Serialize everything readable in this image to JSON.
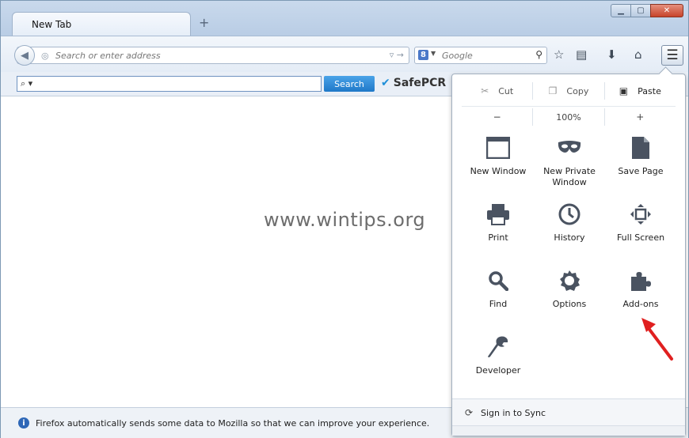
{
  "window": {
    "tab_title": "New Tab",
    "new_tab_symbol": "+",
    "controls": {
      "minimize": "▁",
      "maximize": "▢",
      "close": "✕"
    }
  },
  "navbar": {
    "url_placeholder": "Search or enter address",
    "search_engine": "Google",
    "search_placeholder": "Google"
  },
  "toolbar_addon": {
    "search_symbol": "⌕ ▾",
    "search_button": "Search",
    "brand": "SafePCR"
  },
  "content": {
    "watermark": "www.wintips.org"
  },
  "notification": {
    "text": "Firefox automatically sends some data to Mozilla so that we can improve your experience."
  },
  "menu_panel": {
    "edit": {
      "cut": "Cut",
      "copy": "Copy",
      "paste": "Paste"
    },
    "zoom": {
      "minus": "−",
      "level": "100%",
      "plus": "+"
    },
    "items": [
      {
        "label": "New Window",
        "icon": "window-icon"
      },
      {
        "label": "New Private Window",
        "icon": "mask-icon"
      },
      {
        "label": "Save Page",
        "icon": "page-icon"
      },
      {
        "label": "Print",
        "icon": "printer-icon"
      },
      {
        "label": "History",
        "icon": "clock-icon"
      },
      {
        "label": "Full Screen",
        "icon": "fullscreen-icon"
      },
      {
        "label": "Find",
        "icon": "magnifier-icon"
      },
      {
        "label": "Options",
        "icon": "gear-icon"
      },
      {
        "label": "Add-ons",
        "icon": "puzzle-icon"
      },
      {
        "label": "Developer",
        "icon": "wrench-icon"
      }
    ],
    "sync": "Sign in to Sync"
  },
  "colors": {
    "accent_search_button": "#1f78c8",
    "annotation_arrow": "#e02020"
  }
}
